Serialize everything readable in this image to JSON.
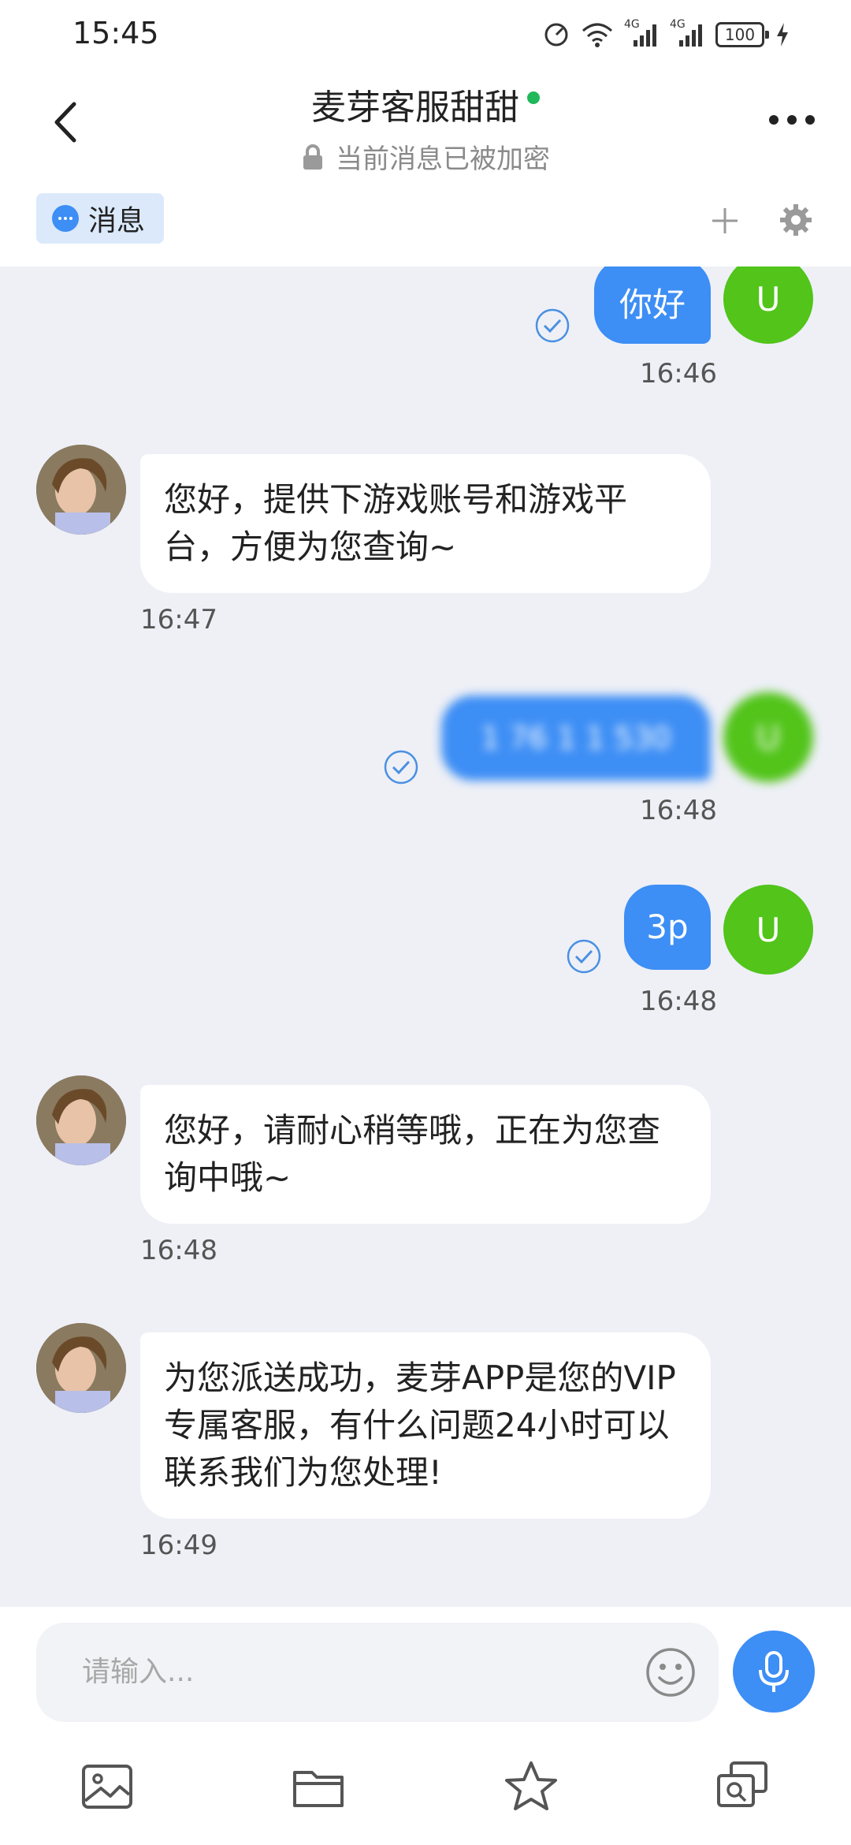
{
  "status_bar": {
    "time": "15:45",
    "network_1": "4G",
    "network_2": "4G",
    "battery": "100"
  },
  "header": {
    "title": "麦芽客服甜甜",
    "subtitle": "当前消息已被加密",
    "online_color": "#1fb85a"
  },
  "tab": {
    "label": "消息"
  },
  "user": {
    "avatar_letter": "U",
    "avatar_color": "#52c41a"
  },
  "messages": [
    {
      "sender": "user",
      "text": "你好",
      "time": "16:46",
      "status": "read"
    },
    {
      "sender": "agent",
      "text": "您好，提供下游戏账号和游戏平台，方便为您查询~",
      "time": "16:47"
    },
    {
      "sender": "user",
      "text": "1 76 1 1 530",
      "time": "16:48",
      "status": "read",
      "redacted": true
    },
    {
      "sender": "user",
      "text": "3p",
      "time": "16:48",
      "status": "read"
    },
    {
      "sender": "agent",
      "text": "您好，请耐心稍等哦，正在为您查询中哦~",
      "time": "16:48"
    },
    {
      "sender": "agent",
      "text": "为您派送成功，麦芽APP是您的VIP专属客服，有什么问题24小时可以联系我们为您处理!",
      "time": "16:49"
    }
  ],
  "input": {
    "placeholder": "请输入..."
  },
  "colors": {
    "accent": "#3d8ef5",
    "chat_background": "#eef0f6"
  },
  "toolbar": {
    "icons": [
      "image-icon",
      "folder-icon",
      "star-icon",
      "screenshot-search-icon"
    ]
  }
}
